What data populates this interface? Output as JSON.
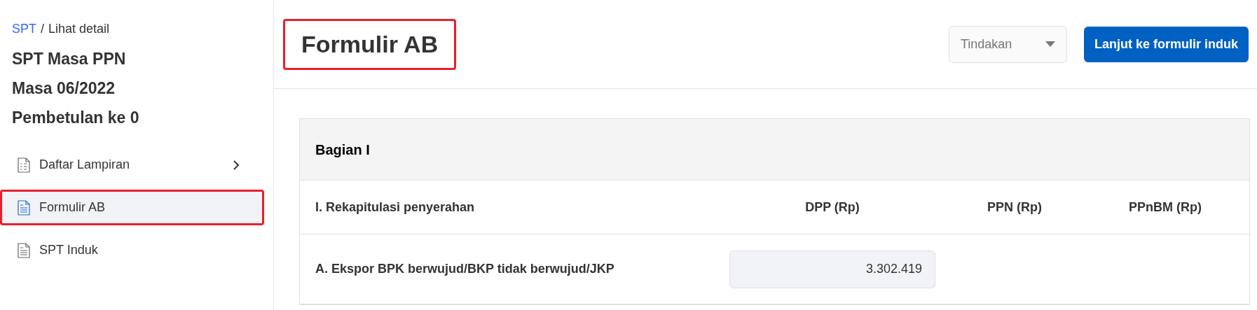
{
  "breadcrumb": {
    "link": "SPT",
    "separator": "/",
    "current": "Lihat detail"
  },
  "sidebar": {
    "title_lines": [
      "SPT Masa PPN",
      "Masa 06/2022",
      "Pembetulan ke 0"
    ],
    "items": [
      {
        "label": "Daftar Lampiran",
        "kind": "group",
        "selected": false,
        "highlighted": false
      },
      {
        "label": "Formulir AB",
        "kind": "page",
        "selected": true,
        "highlighted": true
      },
      {
        "label": "SPT Induk",
        "kind": "page",
        "selected": false,
        "highlighted": false
      }
    ]
  },
  "header": {
    "title": "Formulir AB",
    "title_highlighted": true,
    "action_dropdown": {
      "placeholder": "Tindakan"
    },
    "primary_button": "Lanjut ke formulir induk"
  },
  "section": {
    "title": "Bagian I",
    "table": {
      "columns": [
        "I. Rekapitulasi penyerahan",
        "DPP (Rp)",
        "PPN (Rp)",
        "PPnBM (Rp)"
      ],
      "rows": [
        {
          "label": "A. Ekspor BPK berwujud/BKP tidak berwujud/JKP",
          "dpp": "3.302.419"
        }
      ]
    }
  }
}
